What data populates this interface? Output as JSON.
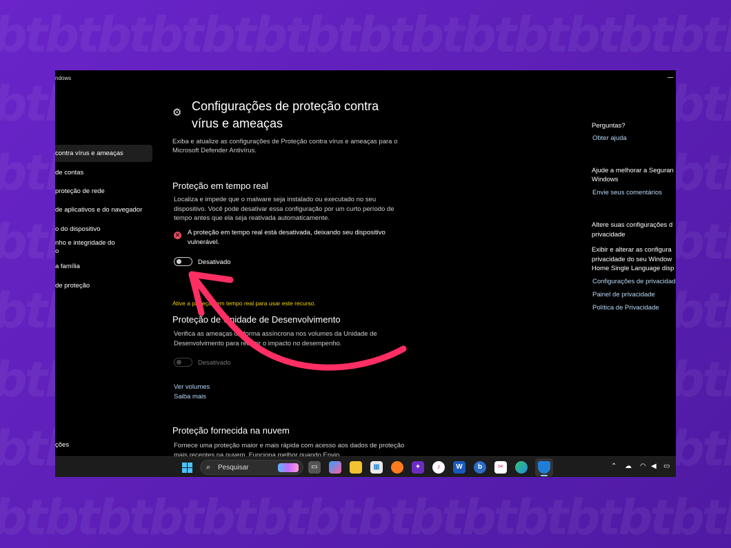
{
  "window": {
    "title": "ndows"
  },
  "sidebar": {
    "items": [
      {
        "label": "contra vírus e ameaças",
        "active": true
      },
      {
        "label": "de contas"
      },
      {
        "label": "proteção de rede"
      },
      {
        "label": "de aplicativos e do navegador"
      },
      {
        "label": "o do dispositivo"
      },
      {
        "label": "nho e integridade do"
      },
      {
        "label": "o"
      },
      {
        "label": "a família"
      },
      {
        "label": "de proteção"
      }
    ],
    "bottom_item": "ções"
  },
  "main": {
    "title": "Configurações de proteção contra vírus e ameaças",
    "description": "Exiba e atualize as configurações de Proteção contra vírus e ameaças para o Microsoft Defender Antivírus.",
    "realtime": {
      "title": "Proteção em tempo real",
      "description": "Localiza e impede que o malware seja instalado ou executado no seu dispositivo. Você pode desativar essa configuração por um curto período de tempo antes que ela seja reativada automaticamente.",
      "warning": "A proteção em tempo real está desativada, deixando seu dispositivo vulnerável.",
      "toggle_label": "Desativado",
      "toggle_on": false
    },
    "dev_drive": {
      "note": "Ative a proteção em tempo real para usar este recurso.",
      "title": "Proteção de Unidade de Desenvolvimento",
      "description": "Verifica as ameaças de forma assíncrona nos volumes da Unidade de Desenvolvimento para reduzir o impacto no desempenho.",
      "toggle_label": "Desativado",
      "toggle_on": false,
      "link_volumes": "Ver volumes",
      "link_more": "Saiba mais"
    },
    "cloud": {
      "title": "Proteção fornecida na nuvem",
      "description": "Fornece uma proteção maior e mais rápida com acesso aos dados de proteção mais recentes na nuvem. Funciona melhor quando Envio"
    }
  },
  "right": {
    "questions_heading": "Perguntas?",
    "get_help": "Obter ajuda",
    "improve_line1": "Ajude a melhorar a Seguran",
    "improve_line2": "Windows",
    "feedback": "Envie seus comentários",
    "privacy_line1": "Altere suas configurações d",
    "privacy_line2": "privacidade",
    "privacy_desc1": "Exibir e alterar as configura",
    "privacy_desc2": "privacidade do seu Window",
    "privacy_desc3": "Home Single Language disp",
    "privacy_settings": "Configurações de privacidade",
    "privacy_dashboard": "Painel de privacidade",
    "privacy_policy": "Política de Privacidade"
  },
  "taskbar": {
    "search_placeholder": "Pesquisar",
    "apps": [
      "task-view",
      "copilot",
      "file-explorer",
      "microsoft-store",
      "firefox",
      "affinity",
      "itunes",
      "word",
      "edge-dev",
      "snip",
      "edge",
      "windows-security"
    ]
  },
  "colors": {
    "accent_link": "#b9d8f7",
    "warning_red": "#e84a5f",
    "note_yellow": "#f5d400",
    "arrow": "#ff2e63"
  }
}
